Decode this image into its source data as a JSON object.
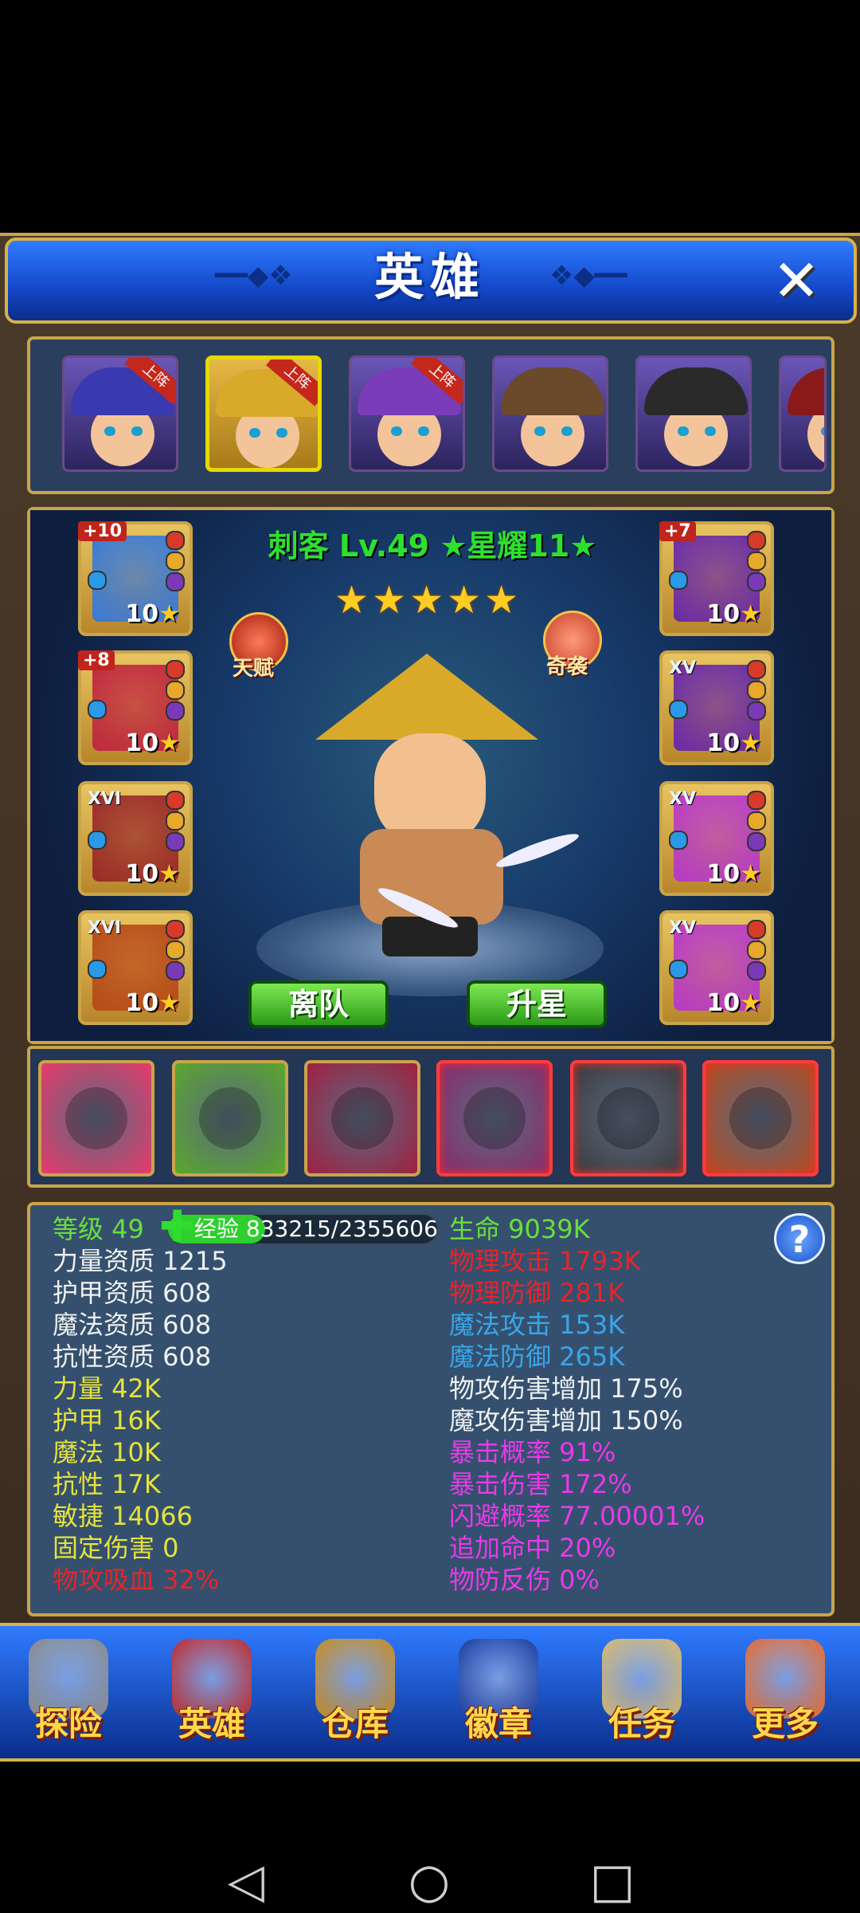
{
  "window": {
    "title": "英雄",
    "close_glyph": "✕"
  },
  "roster": [
    {
      "hat_color": "#3a3ab0",
      "in_lineup": true,
      "lineup_label": "上阵"
    },
    {
      "hat_color": "#d9aa2a",
      "in_lineup": true,
      "lineup_label": "上阵",
      "selected": true
    },
    {
      "hat_color": "#7a3cb8",
      "in_lineup": true,
      "lineup_label": "上阵"
    },
    {
      "hat_color": "#6a4a2a",
      "in_lineup": false
    },
    {
      "hat_color": "#2a2a2a",
      "in_lineup": false
    },
    {
      "hat_color": "#8a1a1a",
      "in_lineup": false
    }
  ],
  "hero": {
    "heading": "刺客 Lv.49  ★星耀11★",
    "star_glyphs": "★★★★★",
    "talent_label": "天赋",
    "special_label": "奇袭"
  },
  "equipment": {
    "left": [
      {
        "plus": "+10",
        "level": "10",
        "icon": "spear-icon",
        "color": "#3a7ad8"
      },
      {
        "plus": "+8",
        "level": "10",
        "icon": "witch-hat-icon",
        "color": "#c02840"
      },
      {
        "rank": "XVI",
        "level": "10",
        "icon": "armor-icon",
        "color": "#9a2a2a"
      },
      {
        "rank": "XVI",
        "level": "10",
        "icon": "boots-icon",
        "color": "#b84a1a"
      }
    ],
    "right": [
      {
        "plus": "+7",
        "level": "10",
        "icon": "amulet-icon",
        "color": "#6a2aa8"
      },
      {
        "rank": "XV",
        "level": "10",
        "icon": "amulet-icon",
        "color": "#6a2aa8"
      },
      {
        "rank": "XV",
        "level": "10",
        "icon": "ring-icon",
        "color": "#b83ac8"
      },
      {
        "rank": "XV",
        "level": "10",
        "icon": "ring-icon",
        "color": "#b83ac8"
      }
    ]
  },
  "buttons": {
    "leave_team": "离队",
    "upgrade_star": "升星"
  },
  "skills": [
    {
      "icon": "mace-icon",
      "color": "#e83a6a",
      "active": false
    },
    {
      "icon": "skull-icon",
      "color": "#5aa82a",
      "active": false
    },
    {
      "icon": "claw-icon",
      "color": "#a02040",
      "active": false
    },
    {
      "icon": "gold-shield-icon",
      "color": "#8a2a6a",
      "active": true
    },
    {
      "icon": "green-shield-icon",
      "color": "#3a3a3a",
      "active": true
    },
    {
      "icon": "orange-shield-icon",
      "color": "#b84a1a",
      "active": true
    }
  ],
  "stats": {
    "level": "等级 49",
    "exp_label": "经验 833215/2355606",
    "exp_fraction": 0.354,
    "left": [
      {
        "text": "力量资质  1215",
        "color": "white"
      },
      {
        "text": "护甲资质  608",
        "color": "white"
      },
      {
        "text": "魔法资质  608",
        "color": "white"
      },
      {
        "text": "抗性资质  608",
        "color": "white"
      },
      {
        "text": "力量  42K",
        "color": "yellow"
      },
      {
        "text": "护甲  16K",
        "color": "yellow"
      },
      {
        "text": "魔法  10K",
        "color": "yellow"
      },
      {
        "text": "抗性  17K",
        "color": "yellow"
      },
      {
        "text": "敏捷  14066",
        "color": "yellow"
      },
      {
        "text": "固定伤害  0",
        "color": "yellow"
      },
      {
        "text": "物攻吸血  32%",
        "color": "red"
      }
    ],
    "right": [
      {
        "text": "生命  9039K",
        "color": "green"
      },
      {
        "text": "物理攻击  1793K",
        "color": "red"
      },
      {
        "text": "物理防御  281K",
        "color": "red"
      },
      {
        "text": "魔法攻击  153K",
        "color": "blue"
      },
      {
        "text": "魔法防御  265K",
        "color": "blue"
      },
      {
        "text": "物攻伤害增加  175%",
        "color": "white"
      },
      {
        "text": "魔攻伤害增加  150%",
        "color": "white"
      },
      {
        "text": "暴击概率  91%",
        "color": "magenta"
      },
      {
        "text": "暴击伤害  172%",
        "color": "magenta"
      },
      {
        "text": "闪避概率  77.00001%",
        "color": "magenta"
      },
      {
        "text": "追加命中  20%",
        "color": "magenta"
      },
      {
        "text": "物防反伤  0%",
        "color": "magenta"
      }
    ],
    "help_glyph": "?"
  },
  "nav": [
    {
      "label": "探险",
      "icon": "sword-icon",
      "color": "#8a8a8a"
    },
    {
      "label": "英雄",
      "icon": "helmet-icon",
      "color": "#c02828"
    },
    {
      "label": "仓库",
      "icon": "chest-icon",
      "color": "#c88a1a"
    },
    {
      "label": "徽章",
      "icon": "badge-icon",
      "color": "#1a3a9a"
    },
    {
      "label": "任务",
      "icon": "scroll-icon",
      "color": "#d8b86a"
    },
    {
      "label": "更多",
      "icon": "more-icon",
      "color": "#e86a2a"
    }
  ],
  "system": {
    "back": "◁",
    "home": "○",
    "recents": "□"
  }
}
